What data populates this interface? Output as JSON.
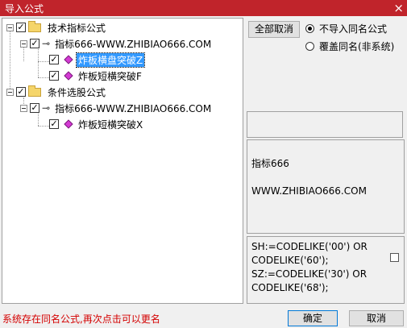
{
  "window": {
    "title": "导入公式",
    "close_glyph": "×"
  },
  "tree": {
    "groups": [
      {
        "label": "技术指标公式",
        "checked": true,
        "formula": {
          "label": "指标666-WWW.ZHIBIAO666.COM",
          "children": [
            {
              "label": "炸板横盘突破Z",
              "selected": true
            },
            {
              "label": "炸板短横突破F",
              "selected": false
            }
          ]
        }
      },
      {
        "label": "条件选股公式",
        "checked": true,
        "formula": {
          "label": "指标666-WWW.ZHIBIAO666.COM",
          "children": [
            {
              "label": "炸板短横突破X",
              "selected": false
            }
          ]
        }
      }
    ]
  },
  "buttons": {
    "cancel_all": "全部取消",
    "ok": "确定",
    "cancel": "取消"
  },
  "options": {
    "no_import_same_name": "不导入同名公式",
    "overwrite_same_name": "覆盖同名(非系统)",
    "selected": "no_import_same_name"
  },
  "info": {
    "line1": "指标666",
    "line2": "WWW.ZHIBIAO666.COM"
  },
  "code": {
    "text": "SH:=CODELIKE('00') OR\nCODELIKE('60');\nSZ:=CODELIKE('30') OR\nCODELIKE('68');"
  },
  "status": {
    "message": "系统存在同名公式,再次点击可以更名"
  },
  "colors": {
    "titlebar": "#c0242b",
    "status_text": "#d40000",
    "selection": "#3399ff",
    "formula_icon": "#d43ad4"
  }
}
